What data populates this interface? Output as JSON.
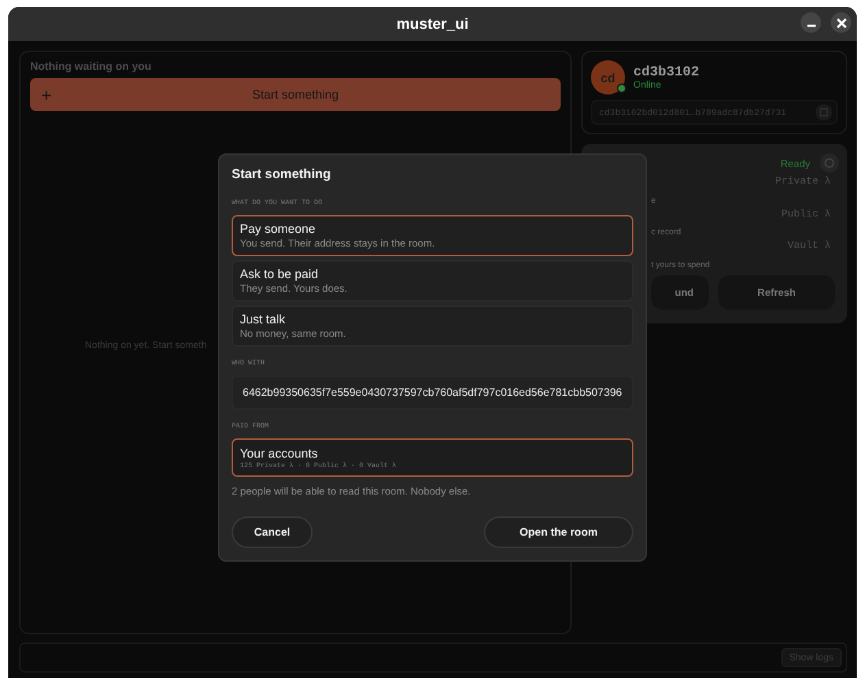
{
  "window": {
    "title": "muster_ui"
  },
  "inbox": {
    "heading": "Nothing waiting on you",
    "start_button": {
      "icon": "+",
      "label": "Start something"
    },
    "empty_text": "Nothing on yet. Start someth"
  },
  "identity": {
    "avatar": "cd",
    "name": "cd3b3102",
    "status": "Online",
    "online": true,
    "address": "cd3b3102bd012d801…b789adc87db27d731"
  },
  "wallet": {
    "status": "Ready",
    "rows": [
      {
        "label": "e",
        "value": "Private λ"
      },
      {
        "label": "c record",
        "value": "Public λ"
      },
      {
        "label": "t yours to spend",
        "value": "Vault λ"
      }
    ],
    "buttons": [
      "und",
      "Refresh"
    ]
  },
  "footer": {
    "button": "Show logs"
  },
  "dialog": {
    "title": "Start something",
    "what_label": "WHAT DO YOU WANT TO DO",
    "options": [
      {
        "title": "Pay someone",
        "subtitle": "You send. Their address stays in the room.",
        "selected": true
      },
      {
        "title": "Ask to be paid",
        "subtitle": "They send. Yours does.",
        "selected": false
      },
      {
        "title": "Just talk",
        "subtitle": "No money, same room.",
        "selected": false
      }
    ],
    "who_label": "WHO WITH",
    "who_value": "6462b99350635f7e559e0430737597cb760af5df797c016ed56e781cbb507396",
    "paid_label": "PAID FROM",
    "account": {
      "title": "Your accounts",
      "detail": "125 Private λ · 0 Public λ · 0 Vault λ",
      "selected": true
    },
    "note": "2 people will be able to read this room. Nobody else.",
    "cancel": "Cancel",
    "confirm": "Open the room"
  }
}
